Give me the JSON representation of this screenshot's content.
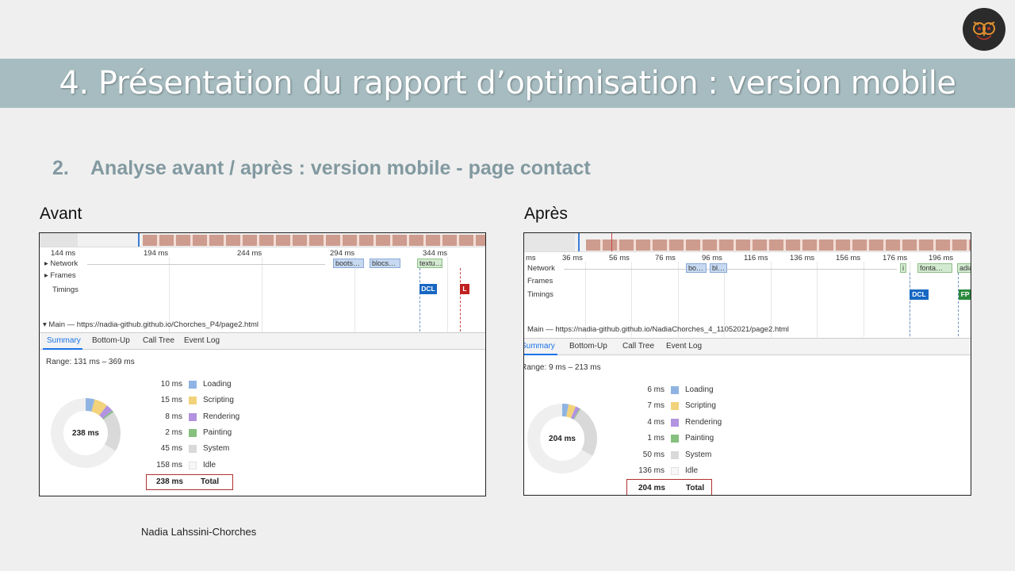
{
  "slide": {
    "title": "4.  Présentation du rapport d’optimisation : version mobile",
    "subtitle_number": "2.",
    "subtitle_text": "Analyse avant / après :  version mobile - page contact",
    "author": "Nadia Lahssini-Chorches",
    "logo_icon": "owl-logo-icon"
  },
  "before": {
    "label": "Avant",
    "ruler": [
      "144 ms",
      "194 ms",
      "244 ms",
      "294 ms",
      "344 ms"
    ],
    "tracks": [
      "Network",
      "Frames",
      "Timings"
    ],
    "network_bars": [
      "boots…",
      "blocs…",
      "textu…"
    ],
    "markers": [
      "DCL",
      "L"
    ],
    "main_thread": "Main — https://nadia-github.github.io/Chorches_P4/page2.html",
    "tabs": [
      "Summary",
      "Bottom-Up",
      "Call Tree",
      "Event Log"
    ],
    "range": "Range: 131 ms – 369 ms",
    "donut_label": "238 ms",
    "summary": [
      {
        "value": "10 ms",
        "name": "Loading",
        "color": "#8fb4e3",
        "ms": 10
      },
      {
        "value": "15 ms",
        "name": "Scripting",
        "color": "#f2d27a",
        "ms": 15
      },
      {
        "value": "8 ms",
        "name": "Rendering",
        "color": "#b193e0",
        "ms": 8
      },
      {
        "value": "2 ms",
        "name": "Painting",
        "color": "#86c07e",
        "ms": 2
      },
      {
        "value": "45 ms",
        "name": "System",
        "color": "#d9d9d9",
        "ms": 45
      },
      {
        "value": "158 ms",
        "name": "Idle",
        "color": "#f7f7f7",
        "ms": 158
      }
    ],
    "total_value": "238 ms",
    "total_label": "Total"
  },
  "after": {
    "label": "Après",
    "ruler": [
      "ms",
      "36 ms",
      "56 ms",
      "76 ms",
      "96 ms",
      "116 ms",
      "136 ms",
      "156 ms",
      "176 ms",
      "196 ms"
    ],
    "tracks": [
      "Network",
      "Frames",
      "Timings"
    ],
    "network_bars": [
      "bo…",
      "bl…",
      "i",
      "fonta…",
      "adia"
    ],
    "markers": [
      "DCL",
      "FP"
    ],
    "main_thread": "Main — https://nadia-github.github.io/NadiaChorches_4_11052021/page2.html",
    "tabs": [
      "Summary",
      "Bottom-Up",
      "Call Tree",
      "Event Log"
    ],
    "range": "Range: 9 ms – 213 ms",
    "donut_label": "204 ms",
    "summary": [
      {
        "value": "6 ms",
        "name": "Loading",
        "color": "#8fb4e3",
        "ms": 6
      },
      {
        "value": "7 ms",
        "name": "Scripting",
        "color": "#f2d27a",
        "ms": 7
      },
      {
        "value": "4 ms",
        "name": "Rendering",
        "color": "#b193e0",
        "ms": 4
      },
      {
        "value": "1 ms",
        "name": "Painting",
        "color": "#86c07e",
        "ms": 1
      },
      {
        "value": "50 ms",
        "name": "System",
        "color": "#d9d9d9",
        "ms": 50
      },
      {
        "value": "136 ms",
        "name": "Idle",
        "color": "#f7f7f7",
        "ms": 136
      }
    ],
    "total_value": "204 ms",
    "total_label": "Total"
  }
}
